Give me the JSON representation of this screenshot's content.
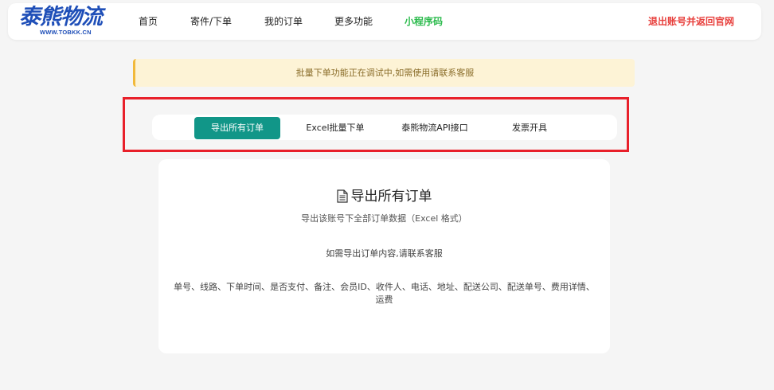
{
  "header": {
    "logo_main": "泰熊物流",
    "logo_sub": "WWW.TOBKK.CN",
    "nav": [
      {
        "label": "首页"
      },
      {
        "label": "寄件/下单"
      },
      {
        "label": "我的订单"
      },
      {
        "label": "更多功能"
      },
      {
        "label": "小程序码"
      }
    ],
    "logout": "退出账号并返回官网"
  },
  "notice": "批量下单功能正在调试中,如需使用请联系客服",
  "tabs": [
    {
      "label": "导出所有订单",
      "active": true
    },
    {
      "label": "Excel批量下单",
      "active": false
    },
    {
      "label": "泰熊物流API接口",
      "active": false
    },
    {
      "label": "发票开具",
      "active": false
    }
  ],
  "card": {
    "icon": "document-icon",
    "title": "导出所有订单",
    "subtitle": "导出该账号下全部订单数据（Excel 格式）",
    "contact": "如需导出订单内容,请联系客服",
    "fields": "单号、线路、下单时间、是否支付、备注、会员ID、收件人、电话、地址、配送公司、配送单号、费用详情、运费"
  },
  "colors": {
    "brand": "#1f4fb8",
    "accent": "#119688",
    "mini_program": "#2dbb4e",
    "logout": "#e8423f",
    "highlight": "#e8202a",
    "notice_bg": "#fdf3d6"
  }
}
